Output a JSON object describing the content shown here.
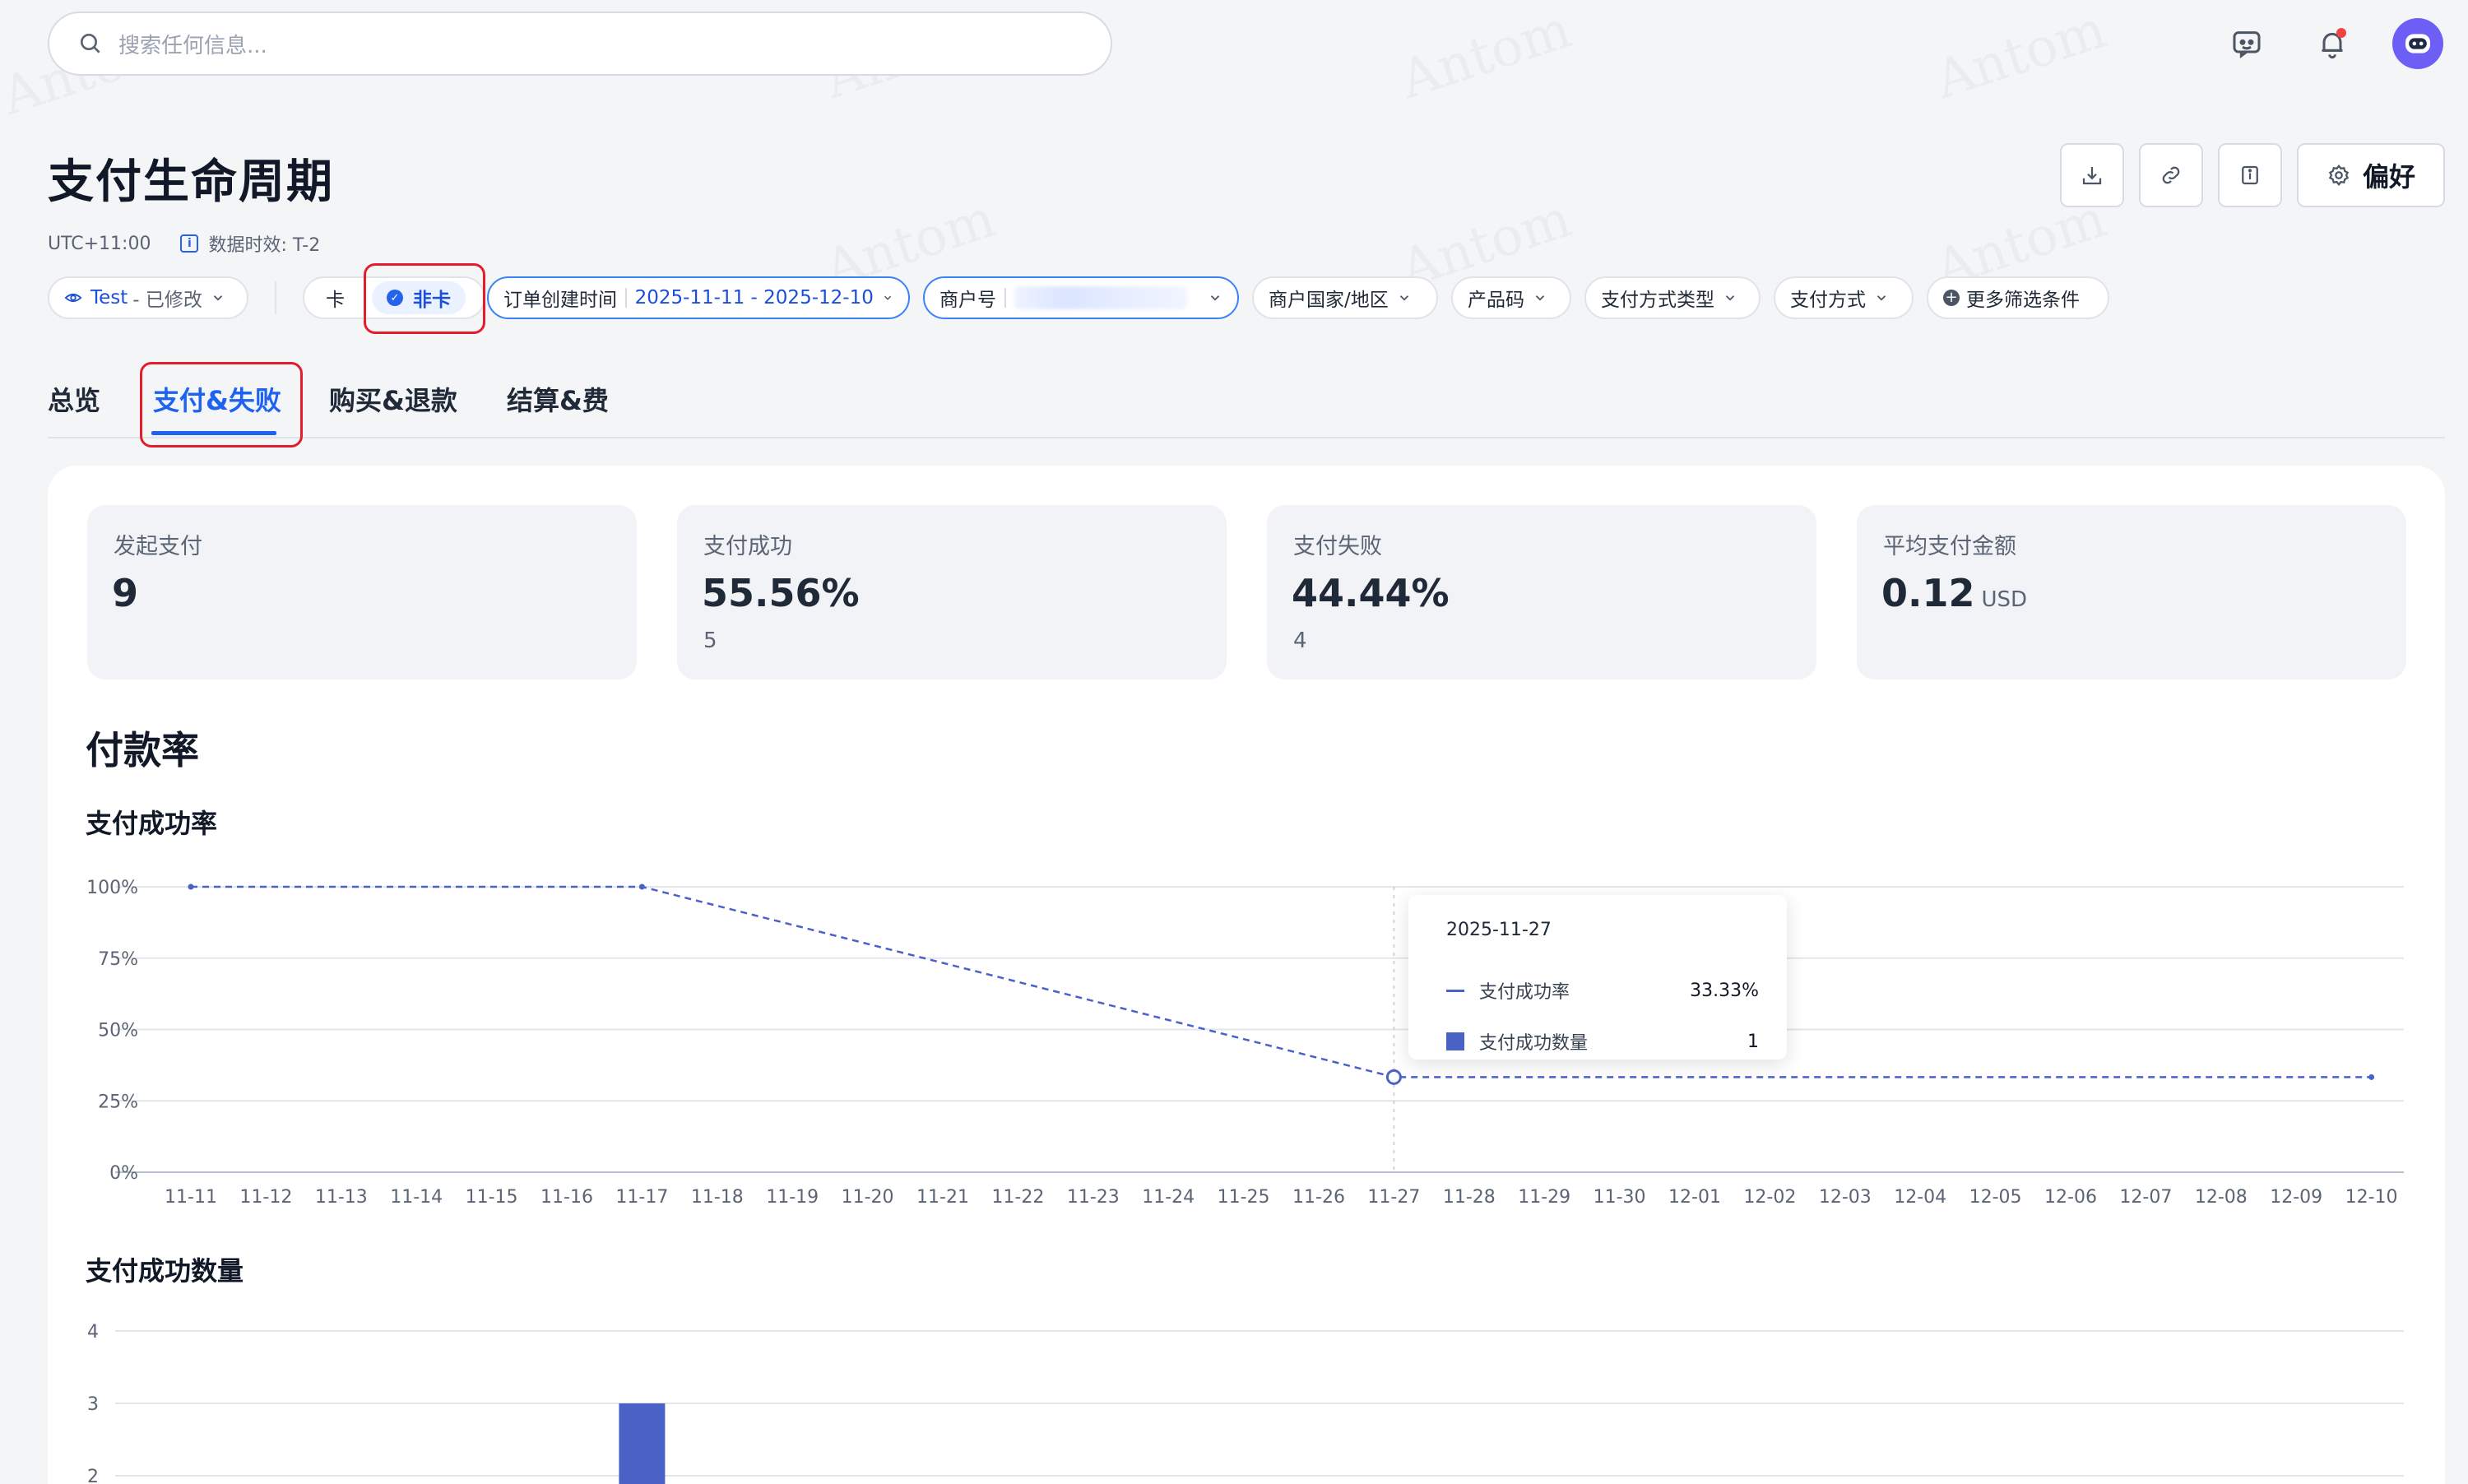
{
  "search": {
    "placeholder": "搜索任何信息..."
  },
  "header": {
    "title": "支付生命周期",
    "timezone": "UTC+11:00",
    "data_timeliness": "数据时效: T-2",
    "preferences_label": "偏好"
  },
  "filters": {
    "env_label": "Test",
    "env_status": "- 已修改",
    "card_option": "卡",
    "noncard_option": "非卡",
    "order_time_label": "订单创建时间",
    "order_time_value": "2025-11-11 - 2025-12-10",
    "merchant_label": "商户号",
    "country_label": "商户国家/地区",
    "product_code_label": "产品码",
    "payment_method_type_label": "支付方式类型",
    "payment_method_label": "支付方式",
    "more_filters_label": "更多筛选条件"
  },
  "tabs": [
    {
      "label": "总览",
      "active": false
    },
    {
      "label": "支付&失败",
      "active": true
    },
    {
      "label": "购买&退款",
      "active": false
    },
    {
      "label": "结算&费",
      "active": false
    }
  ],
  "kpis": [
    {
      "label": "发起支付",
      "value": "9",
      "sub": ""
    },
    {
      "label": "支付成功",
      "value": "55.56%",
      "sub": "5"
    },
    {
      "label": "支付失败",
      "value": "44.44%",
      "sub": "4"
    },
    {
      "label": "平均支付金额",
      "value": "0.12",
      "unit": "USD",
      "sub": ""
    }
  ],
  "section": {
    "title": "付款率",
    "chart1_title": "支付成功率",
    "chart2_title": "支付成功数量"
  },
  "tooltip": {
    "date": "2025-11-27",
    "rows": [
      {
        "name": "支付成功率",
        "value": "33.33%"
      },
      {
        "name": "支付成功数量",
        "value": "1"
      }
    ]
  },
  "colors": {
    "accent": "#1d63f0",
    "series": "#4a62c5",
    "highlight_box": "#e11d2e"
  },
  "icons": {
    "search": "search-icon",
    "feedback": "feedback-icon",
    "notifications": "bell-icon",
    "download": "download-icon",
    "link": "link-icon",
    "info": "info-icon",
    "settings": "gear-icon"
  },
  "chart_data": [
    {
      "type": "line",
      "title": "支付成功率",
      "x": [
        "11-11",
        "11-12",
        "11-13",
        "11-14",
        "11-15",
        "11-16",
        "11-17",
        "11-18",
        "11-19",
        "11-20",
        "11-21",
        "11-22",
        "11-23",
        "11-24",
        "11-25",
        "11-26",
        "11-27",
        "11-28",
        "11-29",
        "11-30",
        "12-01",
        "12-02",
        "12-03",
        "12-04",
        "12-05",
        "12-06",
        "12-07",
        "12-08",
        "12-09",
        "12-10"
      ],
      "yticks": [
        "0%",
        "25%",
        "50%",
        "75%",
        "100%"
      ],
      "ylim": [
        0,
        100
      ],
      "points": [
        {
          "x": "11-11",
          "y": 100
        },
        {
          "x": "11-17",
          "y": 100
        },
        {
          "x": "11-27",
          "y": 33.33
        },
        {
          "x": "12-10",
          "y": 33.33
        }
      ],
      "line_style": "dashed",
      "grid": true
    },
    {
      "type": "bar",
      "title": "支付成功数量",
      "yticks": [
        "2",
        "3",
        "4"
      ],
      "ylim": [
        0,
        4
      ],
      "bars": [
        {
          "x": "11-17",
          "y": 3
        }
      ]
    }
  ]
}
